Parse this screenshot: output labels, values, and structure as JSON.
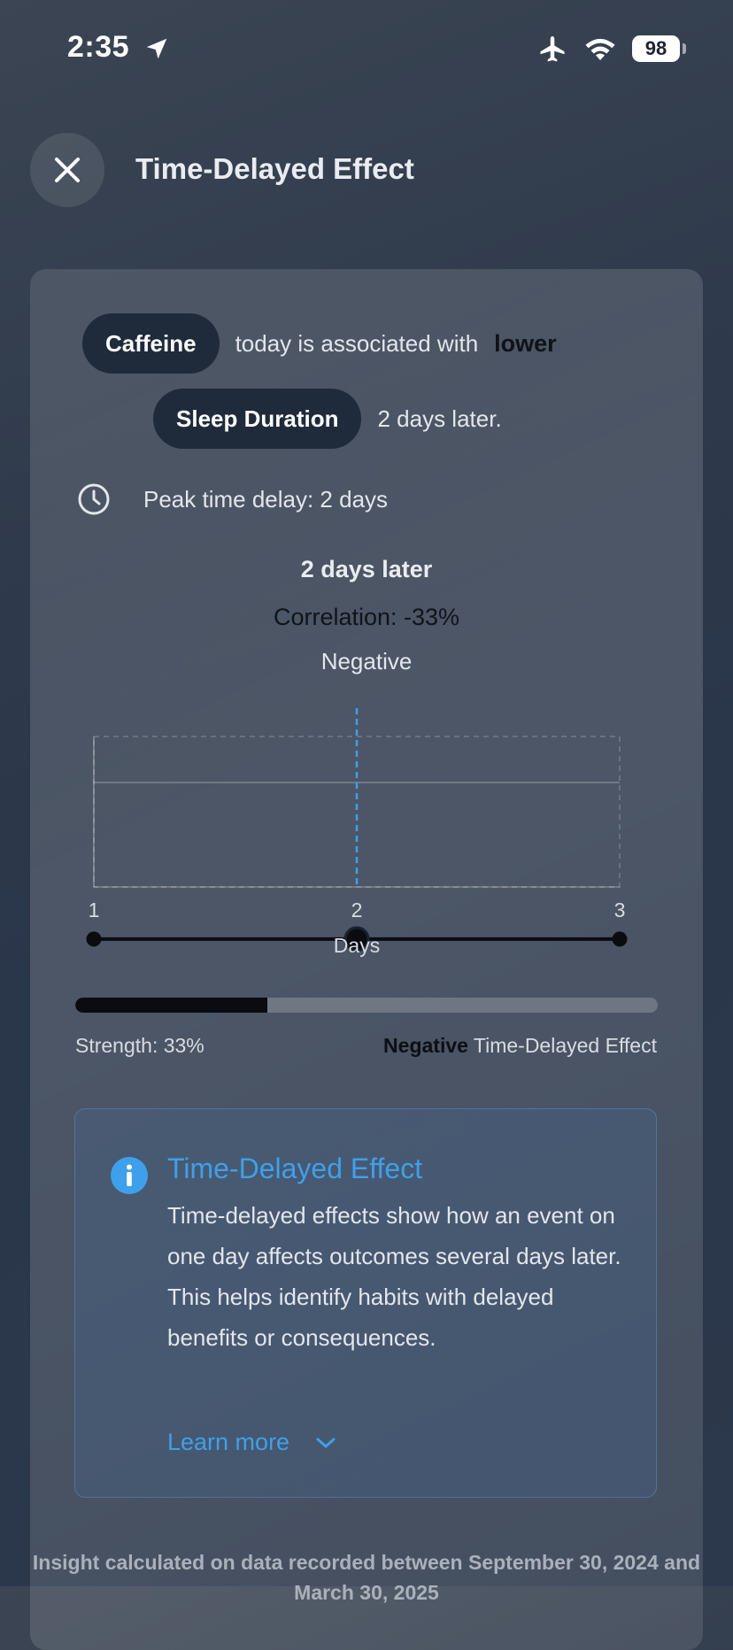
{
  "status_bar": {
    "time": "2:35",
    "battery": "98",
    "icons": [
      "location-arrow-icon",
      "airplane-icon",
      "wifi-icon",
      "battery-icon"
    ]
  },
  "header": {
    "title": "Time-Delayed Effect",
    "close_icon": "close-icon"
  },
  "sentence": {
    "cause_pill": "Caffeine",
    "connector": "today is associated with",
    "direction_word": "lower",
    "effect_pill": "Sleep Duration",
    "delay_text": "2 days later."
  },
  "peak": {
    "icon": "clock-icon",
    "text": "Peak time delay: 2 days"
  },
  "selected_lag": {
    "title": "2 days later",
    "correlation": "Correlation: -33%",
    "direction": "Negative"
  },
  "chart_data": {
    "type": "line",
    "x": [
      1,
      2,
      3
    ],
    "y": [
      -0.33,
      -0.33,
      -0.33
    ],
    "xticks": [
      "1",
      "2",
      "3"
    ],
    "xlabel": "Days",
    "ylim": [
      -1,
      1
    ],
    "highlight_x": 2,
    "grid": true
  },
  "strength": {
    "value": 0.33,
    "label": "Strength: 33%",
    "effect_bold": "Negative",
    "effect_rest": "Time-Delayed Effect"
  },
  "info": {
    "icon": "info-icon",
    "title": "Time-Delayed Effect",
    "body": "Time-delayed effects show how an event on one day affects outcomes several days later. This helps identify habits with delayed benefits or consequences.",
    "learn_more": "Learn more",
    "chevron_icon": "chevron-down-icon"
  },
  "footer": {
    "text": "Insight calculated on data recorded between September 30, 2024 and March 30, 2025"
  },
  "colors": {
    "accent_blue": "#3ea0ea",
    "pill_bg": "#1f2a3b",
    "dashed_marker": "#3ea0ea"
  }
}
